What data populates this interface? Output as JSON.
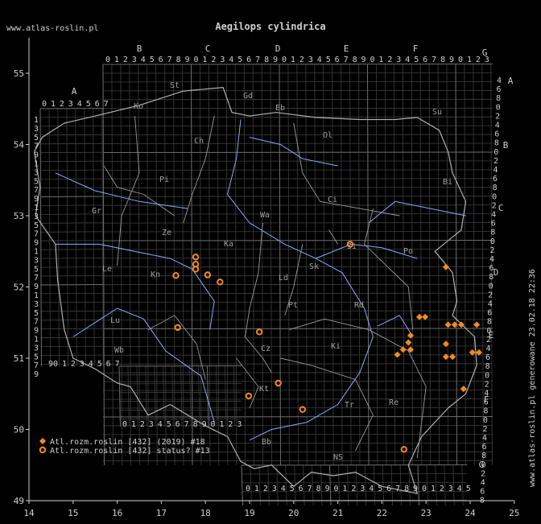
{
  "title": "Aegilops cylindrica",
  "site": "www.atlas-roslin.pl",
  "side_note": "www.atlas-roslin.pl generowane 23.02.18 22:36",
  "x_ticks": [
    "14",
    "15",
    "16",
    "17",
    "18",
    "19",
    "20",
    "21",
    "22",
    "23",
    "24",
    "25"
  ],
  "y_ticks": [
    "55",
    "54",
    "53",
    "52",
    "51",
    "50",
    "49"
  ],
  "col_letters": [
    "A",
    "B",
    "C",
    "D",
    "E",
    "F",
    "G"
  ],
  "row_letters": [
    "A",
    "B",
    "C",
    "D",
    "E",
    "F",
    "G"
  ],
  "region_labels": [
    "St",
    "Ko",
    "Gd",
    "Eb",
    "Su",
    "Ch",
    "Ol",
    "Pi",
    "Bi",
    "Ci",
    "Gr",
    "Wa",
    "Si",
    "Po",
    "Ze",
    "Le",
    "Kn",
    "Ka",
    "Ld",
    "Sk",
    "Pt",
    "Rd",
    "Lu",
    "Wb",
    "Ki",
    "Cz",
    "Kt",
    "Tr",
    "Bb",
    "NS",
    "Re"
  ],
  "legend": [
    {
      "marker": "diamond",
      "label": "Atl.rozm.roslin [432] (2019) #18",
      "color": "#f28c1c"
    },
    {
      "marker": "circle",
      "label": "Atl.rozm.roslin [432] status? #13",
      "color": "#f28c1c"
    }
  ],
  "chart_data": {
    "type": "scatter",
    "title": "Aegilops cylindrica",
    "xlim": [
      14,
      25
    ],
    "ylim": [
      49,
      55.5
    ],
    "series": [
      {
        "name": "Atl.rozm.roslin [432] (2019) #18",
        "marker": "diamond",
        "points": [
          [
            23.45,
            52.28
          ],
          [
            22.85,
            51.58
          ],
          [
            22.98,
            51.58
          ],
          [
            23.5,
            51.47
          ],
          [
            23.65,
            51.47
          ],
          [
            23.8,
            51.47
          ],
          [
            24.15,
            51.47
          ],
          [
            23.45,
            51.2
          ],
          [
            22.65,
            51.32
          ],
          [
            22.6,
            51.22
          ],
          [
            22.65,
            51.12
          ],
          [
            22.48,
            51.12
          ],
          [
            22.35,
            51.05
          ],
          [
            23.45,
            51.02
          ],
          [
            23.6,
            51.02
          ],
          [
            24.05,
            51.08
          ],
          [
            24.2,
            51.08
          ],
          [
            23.85,
            50.57
          ]
        ]
      },
      {
        "name": "Atl.rozm.roslin [432] status? #13",
        "marker": "circle",
        "points": [
          [
            21.28,
            52.6
          ],
          [
            17.78,
            52.42
          ],
          [
            17.78,
            52.32
          ],
          [
            17.78,
            52.25
          ],
          [
            17.33,
            52.16
          ],
          [
            18.05,
            52.17
          ],
          [
            18.33,
            52.07
          ],
          [
            17.37,
            51.43
          ],
          [
            19.22,
            51.37
          ],
          [
            19.65,
            50.65
          ],
          [
            18.98,
            50.47
          ],
          [
            20.2,
            50.28
          ],
          [
            22.5,
            49.72
          ]
        ]
      }
    ]
  }
}
